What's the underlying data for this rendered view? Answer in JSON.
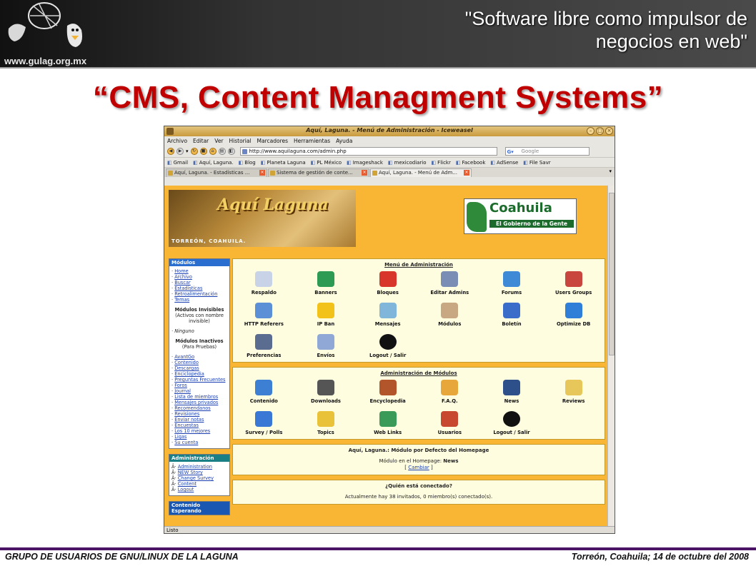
{
  "slide": {
    "logo_text": "www.gulag.org.mx",
    "header_title_line1": "\"Software libre como impulsor de",
    "header_title_line2": "negocios en web\"",
    "title": "“CMS, Content Managment Systems”",
    "footer_left": "GRUPO DE USUARIOS DE GNU/LINUX DE LA LAGUNA",
    "footer_right": "Torreón, Coahuila; 14 de octubre del 2008"
  },
  "browser": {
    "window_title": "Aquí, Laguna. - Menú de Administración - Iceweasel",
    "menu": [
      "Archivo",
      "Editar",
      "Ver",
      "Historial",
      "Marcadores",
      "Herramientas",
      "Ayuda"
    ],
    "url": "http://www.aquilaguna.com/admin.php",
    "search_placeholder": "Google",
    "bookmarks": [
      "Gmail",
      "Aquí, Laguna.",
      "Blog",
      "Planeta Laguna",
      "PL México",
      "Imageshack",
      "mexicodiario",
      "Flickr",
      "Facebook",
      "AdSense",
      "File Savr"
    ],
    "tabs": [
      "Aquí, Laguna. - Estadísticas ...",
      "Sistema de gestión de conte...",
      "Aquí, Laguna. - Menú de Adm..."
    ],
    "status": "Listo"
  },
  "site": {
    "banner_title": "Aquí Laguna",
    "banner_location": "TORREÓN, COAHUILA.",
    "coahuila_name": "Coahuila",
    "coahuila_sub": "El Gobierno de la Gente"
  },
  "sidebar": {
    "modules_title": "Módulos",
    "modules_links": [
      "Home",
      "Archivo",
      "Buscar",
      "Estadísticas",
      "Retroalimentación",
      "Temas"
    ],
    "invisible_title": "Módulos Invisibles",
    "invisible_sub": "(Activos con nombre invisible)",
    "invisible_none": "Ninguno",
    "inactive_title": "Módulos Inactivos",
    "inactive_sub": "(Para Pruebas)",
    "inactive_links": [
      "AvantGo",
      "Contenido",
      "Descargas",
      "Enciclopedia",
      "Preguntas Frecuentes",
      "Foros",
      "Journal",
      "Lista de miembros",
      "Mensajes privados",
      "Recomendanos",
      "Revisiones",
      "Enviar notas",
      "Encuestas",
      "Los 10 mejores",
      "Ligas",
      "Su cuenta"
    ],
    "admin_title": "Administración",
    "admin_links": [
      "Administration",
      "NEW Story",
      "Change Survey",
      "Content",
      "Logout"
    ],
    "waiting_title": "Contenido Esperando"
  },
  "main": {
    "admin_menu_title": "Menú de Administración",
    "admin_icons": [
      {
        "label": "Respaldo",
        "icon": "backup-icon",
        "color": "#c9d3e8"
      },
      {
        "label": "Banners",
        "icon": "banners-icon",
        "color": "#2e9b55"
      },
      {
        "label": "Bloques",
        "icon": "blocks-icon",
        "color": "#d9362b"
      },
      {
        "label": "Editar Admins",
        "icon": "admins-icon",
        "color": "#7a8db5"
      },
      {
        "label": "Forums",
        "icon": "forums-icon",
        "color": "#3e8ad6"
      },
      {
        "label": "Users Groups",
        "icon": "users-groups-icon",
        "color": "#c8463e"
      },
      {
        "label": "HTTP Referers",
        "icon": "referers-icon",
        "color": "#5b8fd6"
      },
      {
        "label": "IP Ban",
        "icon": "ip-ban-icon",
        "color": "#f2c21b"
      },
      {
        "label": "Mensajes",
        "icon": "messages-icon",
        "color": "#7fb6d9"
      },
      {
        "label": "Módulos",
        "icon": "modules-icon",
        "color": "#c8a882"
      },
      {
        "label": "Boletín",
        "icon": "newsletter-icon",
        "color": "#3a6cc9"
      },
      {
        "label": "Optimize DB",
        "icon": "optimize-db-icon",
        "color": "#2f7fd9"
      },
      {
        "label": "Preferencias",
        "icon": "preferences-icon",
        "color": "#5a6c8f"
      },
      {
        "label": "Envíos",
        "icon": "submissions-icon",
        "color": "#8fa8d6"
      },
      {
        "label": "Logout / Salir",
        "icon": "logout-icon",
        "color": "#111111"
      }
    ],
    "modules_admin_title": "Administración de Módulos",
    "module_icons": [
      {
        "label": "Contenido",
        "icon": "content-icon",
        "color": "#3c7fd3"
      },
      {
        "label": "Downloads",
        "icon": "downloads-icon",
        "color": "#555555"
      },
      {
        "label": "Encyclopedia",
        "icon": "encyclopedia-icon",
        "color": "#b3552a"
      },
      {
        "label": "F.A.Q.",
        "icon": "faq-icon",
        "color": "#e8a73a"
      },
      {
        "label": "News",
        "icon": "news-icon",
        "color": "#2d4f8a"
      },
      {
        "label": "Reviews",
        "icon": "reviews-icon",
        "color": "#e7c65a"
      },
      {
        "label": "Survey / Polls",
        "icon": "survey-icon",
        "color": "#3a78d6"
      },
      {
        "label": "Topics",
        "icon": "topics-icon",
        "color": "#e9c23a"
      },
      {
        "label": "Web Links",
        "icon": "web-links-icon",
        "color": "#3a9b58"
      },
      {
        "label": "Usuarios",
        "icon": "users-icon",
        "color": "#c7482e"
      },
      {
        "label": "Logout / Salir",
        "icon": "logout-icon",
        "color": "#111111"
      }
    ],
    "default_module_title": "Aquí, Laguna.: Módulo por Defecto del Homepage",
    "default_module_text": "Módulo en el Homepage:",
    "default_module_value": "News",
    "change_link": "Cambiar",
    "online_title": "¿Quién está conectado?",
    "online_text": "Actualmente hay 38 invitados, 0 miembro(s) conectado(s)."
  }
}
